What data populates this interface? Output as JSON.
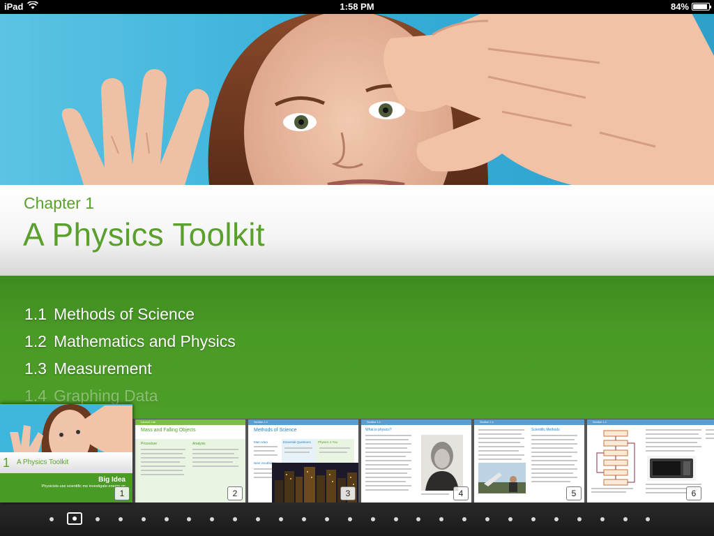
{
  "status_bar": {
    "device": "iPad",
    "time": "1:58 PM",
    "battery_text": "84%",
    "battery_level": 0.84
  },
  "chapter": {
    "label": "Chapter 1",
    "title": "A Physics Toolkit"
  },
  "toc": [
    {
      "num": "1.1",
      "title": "Methods of Science"
    },
    {
      "num": "1.2",
      "title": "Mathematics and Physics"
    },
    {
      "num": "1.3",
      "title": "Measurement"
    },
    {
      "num": "1.4",
      "title": "Graphing Data"
    }
  ],
  "thumbnails": {
    "current": {
      "chapter_num": "1",
      "title": "A Physics Toolkit",
      "big_idea": "Big Idea",
      "big_idea_text": "Physicists use scientific me investigate energy an",
      "page": "1"
    },
    "pages": [
      {
        "page": "2",
        "header": "Launch Lab",
        "title": "Mass and Falling Objects",
        "sub1": "Procedure",
        "sub2": "Analysis"
      },
      {
        "page": "3",
        "header": "Section 1.1",
        "title": "Methods of Science",
        "sub1": "Main Idea",
        "sub2": "Essential Questions",
        "sub3": "Physics 4 You",
        "sub4": "New Vocabulary"
      },
      {
        "page": "4",
        "header": "Section 1.1",
        "title": "What is physics?"
      },
      {
        "page": "5",
        "header": "Section 1.1",
        "title": "Scientific Methods"
      },
      {
        "page": "6",
        "header": "Section 1.1",
        "title": ""
      }
    ]
  },
  "page_dots": {
    "count": 27,
    "current_index": 1
  },
  "colors": {
    "accent_green": "#5aa02c",
    "toc_green": "#4a9a26",
    "sky_blue": "#3fb6dc"
  }
}
